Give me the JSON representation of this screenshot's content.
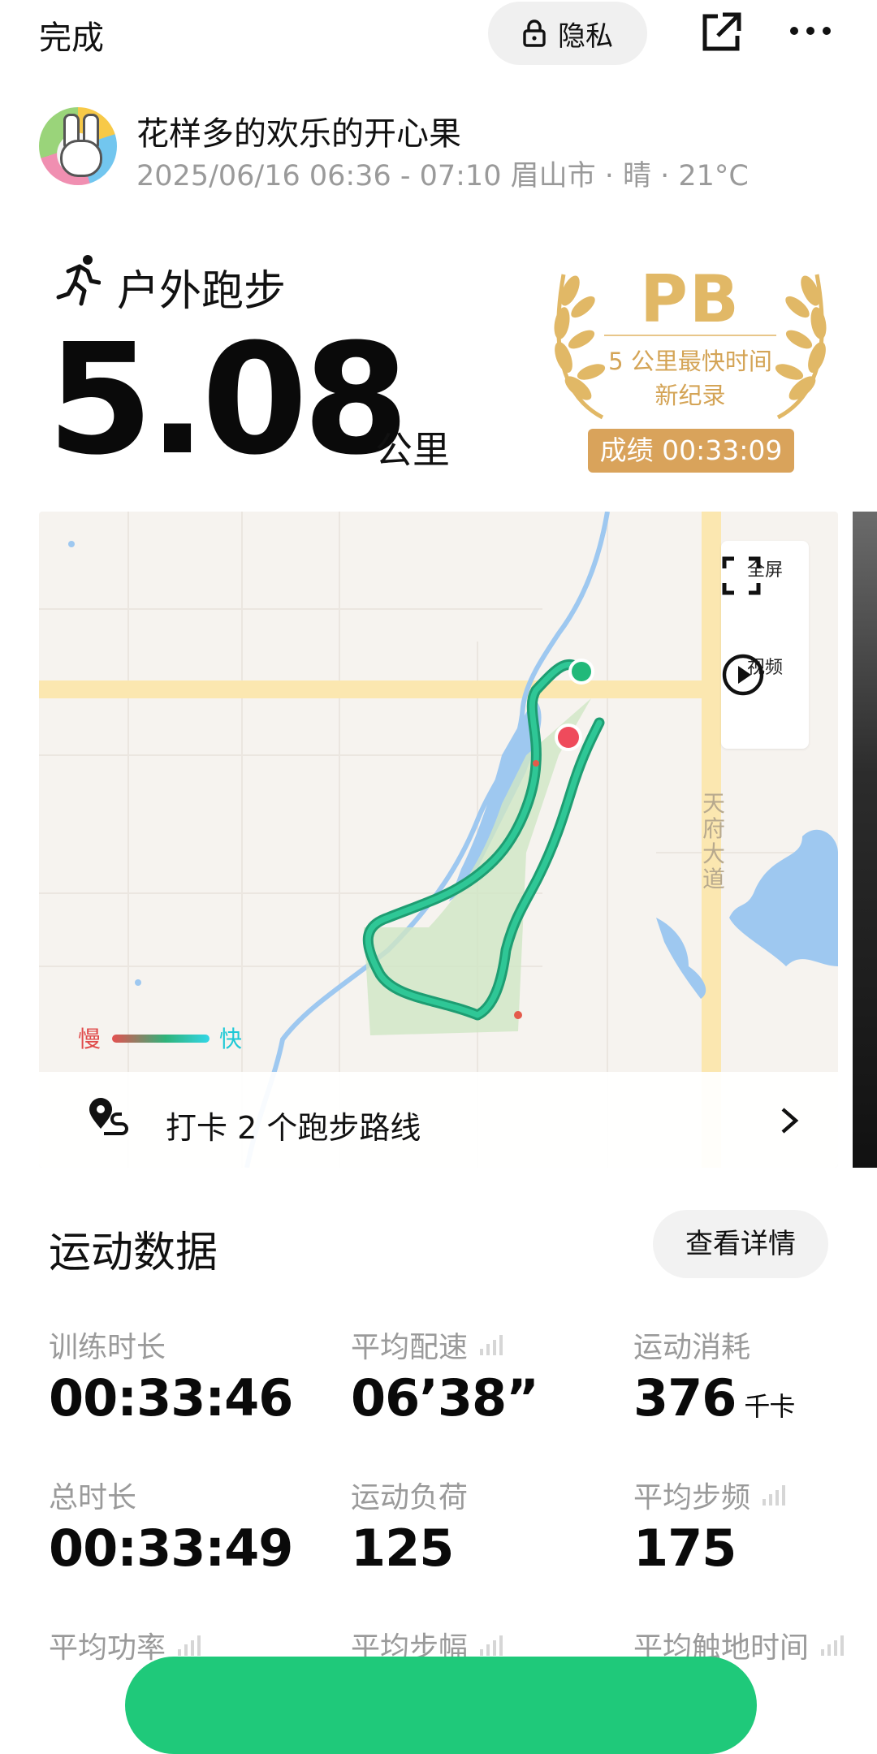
{
  "header": {
    "done_label": "完成",
    "privacy_label": "隐私"
  },
  "profile": {
    "nickname": "花样多的欢乐的开心果",
    "meta": "2025/06/16 06:36 - 07:10 眉山市  ·  晴  ·  21°C"
  },
  "activity": {
    "type": "户外跑步",
    "distance": "5.08",
    "unit": "公里"
  },
  "pb": {
    "title": "PB",
    "line1": "5 公里最快时间",
    "line2": "新纪录",
    "score": "成绩 00:33:09",
    "color": "#d9a35b"
  },
  "map": {
    "fullscreen_label": "全屏",
    "video_label": "视频",
    "road_name": "天府大道",
    "legend_slow": "慢",
    "legend_fast": "快",
    "checkin_text": "打卡 2 个跑步路线"
  },
  "stats": {
    "section_title": "运动数据",
    "detail_button": "查看详情",
    "items": [
      {
        "label": "训练时长",
        "value": "00:33:46",
        "unit": ""
      },
      {
        "label": "平均配速",
        "value": "06’38”",
        "unit": ""
      },
      {
        "label": "运动消耗",
        "value": "376",
        "unit": "千卡"
      },
      {
        "label": "总时长",
        "value": "00:33:49",
        "unit": ""
      },
      {
        "label": "运动负荷",
        "value": "125",
        "unit": ""
      },
      {
        "label": "平均步频",
        "value": "175",
        "unit": ""
      },
      {
        "label": "平均功率",
        "value": "",
        "unit": ""
      },
      {
        "label": "平均步幅",
        "value": "",
        "unit": ""
      },
      {
        "label": "平均触地时间",
        "value": "",
        "unit": ""
      }
    ]
  }
}
